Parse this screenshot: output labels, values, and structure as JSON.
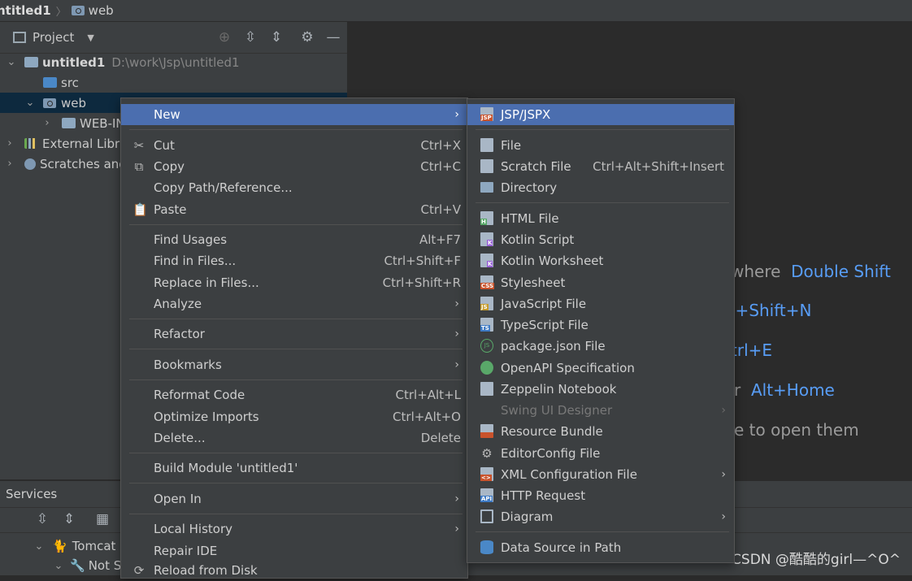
{
  "breadcrumb": {
    "project": "ntitled1",
    "folder": "web"
  },
  "project_panel": {
    "title": "Project",
    "tree": [
      {
        "label": "untitled1",
        "path": "D:\\work\\Jsp\\untitled1"
      },
      {
        "label": "src"
      },
      {
        "label": "web"
      },
      {
        "label": "WEB-IN"
      },
      {
        "label": "External Libra"
      },
      {
        "label": "Scratches and"
      }
    ]
  },
  "services": {
    "title": "Services",
    "rows": [
      {
        "label": "Tomcat"
      },
      {
        "label": "Not S"
      }
    ]
  },
  "editor_hints": [
    {
      "prefix": "where",
      "key": "Double Shift"
    },
    {
      "prefix": "",
      "key": "l+Shift+N"
    },
    {
      "prefix": "",
      "key": "trl+E"
    },
    {
      "prefix": "r",
      "key": "Alt+Home"
    },
    {
      "prefix": "e to open them",
      "key": ""
    }
  ],
  "context_menu": {
    "items": [
      {
        "label": "New",
        "shortcut": "",
        "submenu": true
      },
      {
        "label": "Cut",
        "shortcut": "Ctrl+X"
      },
      {
        "label": "Copy",
        "shortcut": "Ctrl+C"
      },
      {
        "label": "Copy Path/Reference...",
        "shortcut": ""
      },
      {
        "label": "Paste",
        "shortcut": "Ctrl+V"
      },
      {
        "label": "Find Usages",
        "shortcut": "Alt+F7"
      },
      {
        "label": "Find in Files...",
        "shortcut": "Ctrl+Shift+F"
      },
      {
        "label": "Replace in Files...",
        "shortcut": "Ctrl+Shift+R"
      },
      {
        "label": "Analyze",
        "shortcut": "",
        "submenu": true
      },
      {
        "label": "Refactor",
        "shortcut": "",
        "submenu": true
      },
      {
        "label": "Bookmarks",
        "shortcut": "",
        "submenu": true
      },
      {
        "label": "Reformat Code",
        "shortcut": "Ctrl+Alt+L"
      },
      {
        "label": "Optimize Imports",
        "shortcut": "Ctrl+Alt+O"
      },
      {
        "label": "Delete...",
        "shortcut": "Delete"
      },
      {
        "label": "Build Module 'untitled1'",
        "shortcut": ""
      },
      {
        "label": "Open In",
        "shortcut": "",
        "submenu": true
      },
      {
        "label": "Local History",
        "shortcut": "",
        "submenu": true
      },
      {
        "label": "Repair IDE",
        "shortcut": ""
      },
      {
        "label": "Reload from Disk",
        "shortcut": ""
      }
    ]
  },
  "new_submenu": {
    "items": [
      {
        "label": "JSP/JSPX",
        "badge": "JSP"
      },
      {
        "label": "File"
      },
      {
        "label": "Scratch File",
        "shortcut": "Ctrl+Alt+Shift+Insert"
      },
      {
        "label": "Directory"
      },
      {
        "label": "HTML File",
        "badge": "H"
      },
      {
        "label": "Kotlin Script",
        "badge": "K"
      },
      {
        "label": "Kotlin Worksheet",
        "badge": "K"
      },
      {
        "label": "Stylesheet",
        "badge": "CSS"
      },
      {
        "label": "JavaScript File",
        "badge": "JS"
      },
      {
        "label": "TypeScript File",
        "badge": "TS"
      },
      {
        "label": "package.json File",
        "badge": "JS"
      },
      {
        "label": "OpenAPI Specification"
      },
      {
        "label": "Zeppelin Notebook"
      },
      {
        "label": "Swing UI Designer",
        "disabled": true,
        "submenu": true
      },
      {
        "label": "Resource Bundle"
      },
      {
        "label": "EditorConfig File"
      },
      {
        "label": "XML Configuration File",
        "badge": "<>",
        "submenu": true
      },
      {
        "label": "HTTP Request",
        "badge": "API"
      },
      {
        "label": "Diagram",
        "submenu": true
      },
      {
        "label": "Data Source in Path"
      }
    ]
  },
  "watermark": "CSDN @酷酷的girl—^O^",
  "colors": {
    "selection": "#4b6eaf",
    "hint_key": "#589df6",
    "panel_bg": "#3c3f41",
    "editor_bg": "#2b2b2b"
  }
}
